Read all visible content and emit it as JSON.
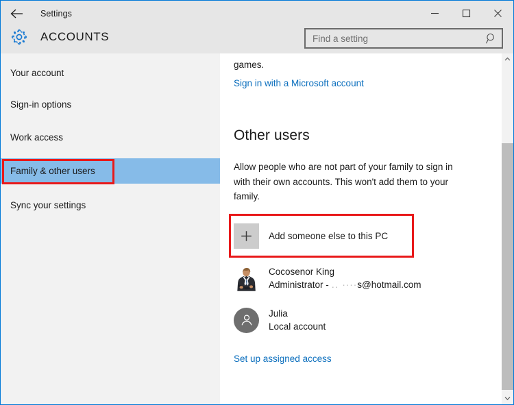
{
  "window": {
    "app_title": "Settings",
    "back_icon": "back-arrow-icon",
    "minimize_label": "Minimize",
    "maximize_label": "Maximize",
    "close_label": "Close",
    "border_color": "#0078d7"
  },
  "header": {
    "gear_icon": "gear-icon",
    "page_title": "ACCOUNTS",
    "accent_color": "#0078d7",
    "background": "#e6e6e6"
  },
  "search": {
    "placeholder": "Find a setting",
    "value": "",
    "icon": "search-icon"
  },
  "sidebar": {
    "background": "#f2f2f2",
    "selected_color": "#86bbe8",
    "items": [
      {
        "label": "Your account",
        "selected": false
      },
      {
        "label": "Sign-in options",
        "selected": false
      },
      {
        "label": "Work access",
        "selected": false
      },
      {
        "label": "Family & other users",
        "selected": true
      },
      {
        "label": "Sync your settings",
        "selected": false
      }
    ]
  },
  "content": {
    "truncated_text": "games.",
    "microsoft_account_link": "Sign in with a Microsoft account",
    "section_heading": "Other users",
    "description": "Allow people who are not part of your family to sign in with their own accounts. This won't add them to your family.",
    "add_user": {
      "label": "Add someone else to this PC",
      "icon": "plus-icon"
    },
    "accounts": [
      {
        "name": "Cocosenor King",
        "detail_prefix": "Administrator - ",
        "detail_redacted": "․․  ····",
        "detail_suffix": "s@hotmail.com",
        "avatar": "user-photo-avatar"
      },
      {
        "name": "Julia",
        "detail": "Local account",
        "avatar": "generic-person-avatar"
      }
    ],
    "assigned_access_link": "Set up assigned access",
    "link_color": "#0a6ebd"
  },
  "scrollbar": {
    "up_arrow_icon": "chevron-up-icon",
    "down_arrow_icon": "chevron-down-icon",
    "thumb_color": "#bdbdbd"
  },
  "annotations": {
    "color": "#e8191a",
    "boxes": [
      {
        "name": "highlight-family-other-users"
      },
      {
        "name": "highlight-add-someone-else"
      }
    ]
  }
}
